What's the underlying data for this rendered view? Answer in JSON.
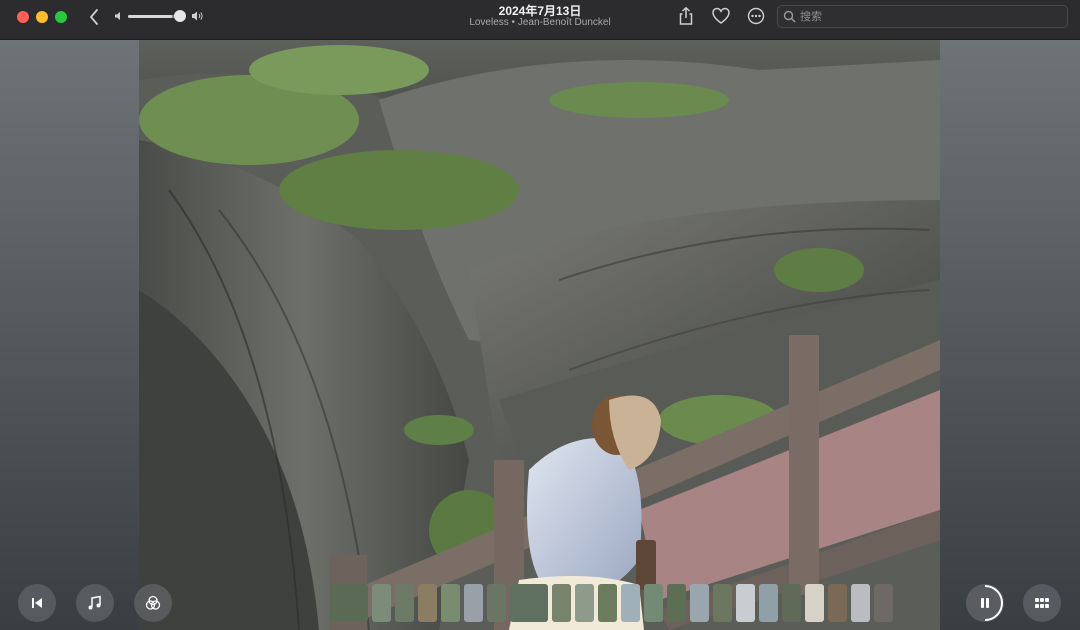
{
  "window": {
    "title": "2024年7月13日",
    "subtitle": "Loveless • Jean-Benoît Dunckel"
  },
  "toolbar": {
    "icons": [
      "chevron-left-icon",
      "volume-low-icon",
      "volume-high-icon",
      "share-icon",
      "heart-icon",
      "more-icon",
      "search-icon"
    ],
    "volume_level": 0.85
  },
  "search": {
    "placeholder": "搜索",
    "value": ""
  },
  "controls": {
    "icons": [
      "skip-back-icon",
      "music-note-icon",
      "filter-icon",
      "pause-icon",
      "grid-icon"
    ]
  },
  "filmstrip": {
    "thumb_count": 28
  },
  "colors": {
    "titlebar": "#2c2c2e",
    "close": "#ff5f57",
    "minimize": "#febc2e",
    "maximize": "#28c840",
    "backdrop_top": "#6d7376",
    "backdrop_bottom": "#3a3e42"
  }
}
